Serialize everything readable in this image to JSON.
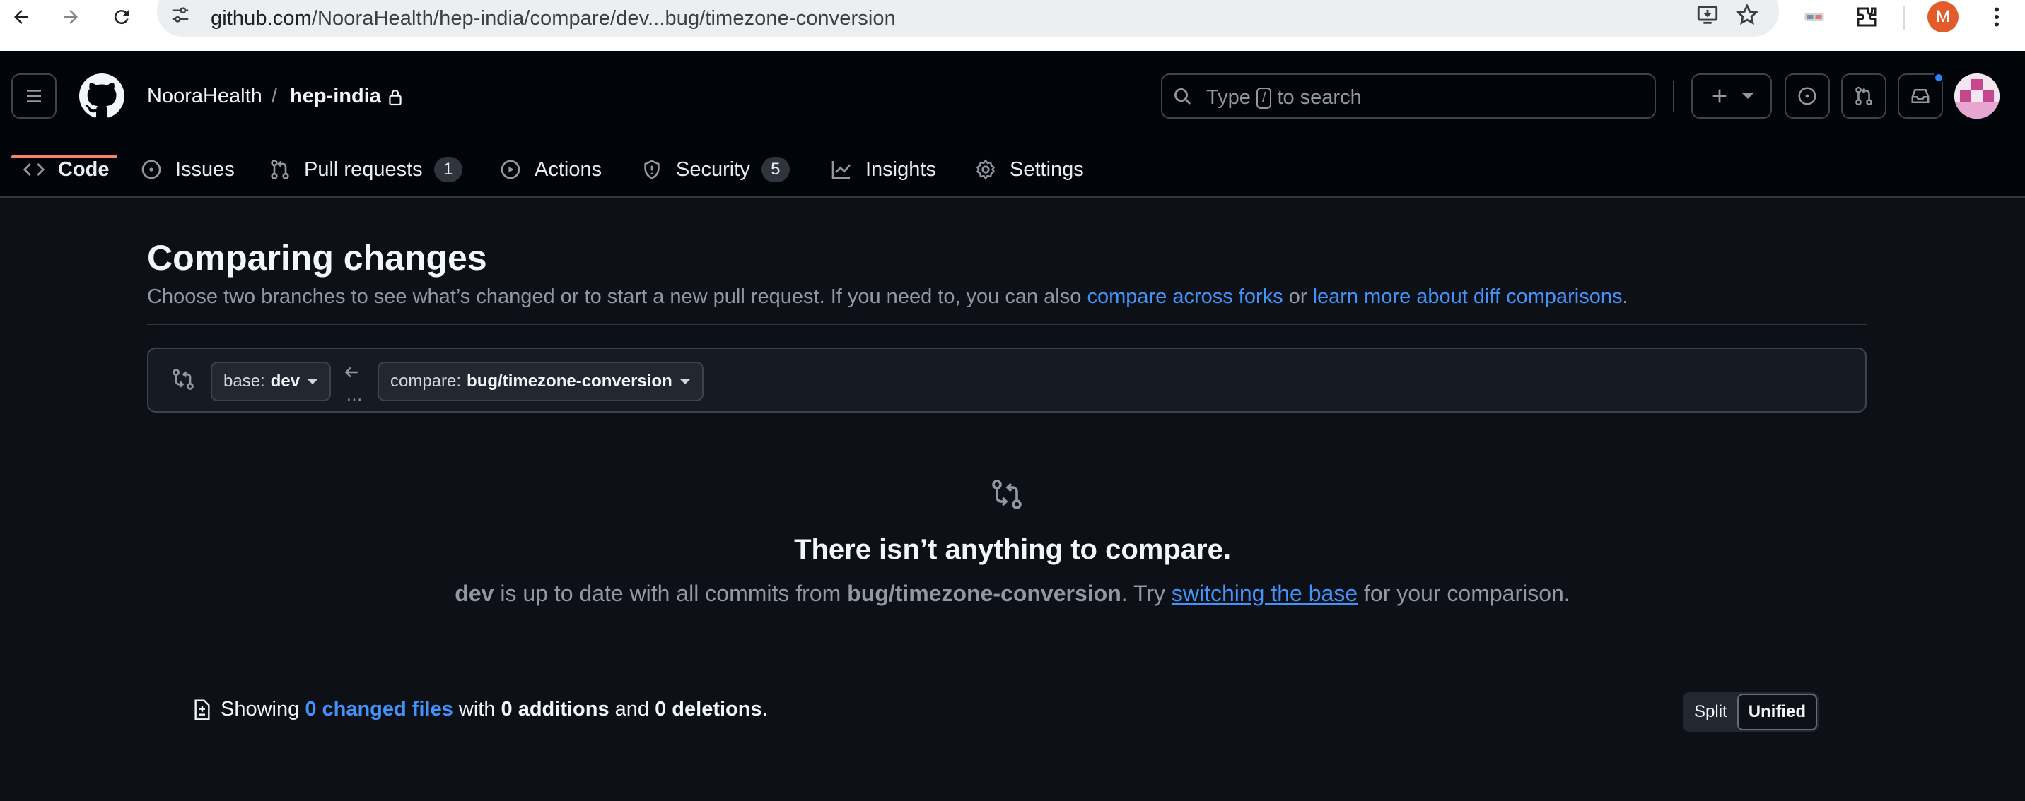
{
  "browser": {
    "url_host": "github.com",
    "url_path": "/NooraHealth/hep-india/compare/dev...bug/timezone-conversion",
    "profile_initial": "M",
    "icons": [
      "back-icon",
      "forward-icon",
      "reload-icon",
      "site-info-icon",
      "install-icon",
      "star-icon",
      "extension-icon",
      "puzzle-icon",
      "menu-dots-icon"
    ]
  },
  "header": {
    "owner": "NooraHealth",
    "separator": "/",
    "repo": "hep-india",
    "search_prefix": "Type",
    "search_key": "/",
    "search_suffix": "to search"
  },
  "tabs": [
    {
      "label": "Code",
      "icon": "code-icon"
    },
    {
      "label": "Issues",
      "icon": "issue-icon"
    },
    {
      "label": "Pull requests",
      "icon": "pull-request-icon",
      "count": "1"
    },
    {
      "label": "Actions",
      "icon": "play-icon"
    },
    {
      "label": "Security",
      "icon": "shield-icon",
      "count": "5"
    },
    {
      "label": "Insights",
      "icon": "graph-icon"
    },
    {
      "label": "Settings",
      "icon": "gear-icon"
    }
  ],
  "main": {
    "title": "Comparing changes",
    "subtitle_text": "Choose two branches to see what’s changed or to start a new pull request. If you need to, you can also",
    "link_forks": "compare across forks",
    "or": "or",
    "link_learn": "learn more about diff comparisons",
    "period": ".",
    "base_label": "base:",
    "base_branch": "dev",
    "compare_label": "compare:",
    "compare_branch": "bug/timezone-conversion",
    "dots": "...",
    "blank_title": "There isn’t anything to compare.",
    "blank_base": "dev",
    "blank_mid": "is up to date with all commits from",
    "blank_head": "bug/timezone-conversion",
    "blank_try": ". Try",
    "blank_link": "switching the base",
    "blank_end": "for your comparison.",
    "showing": "Showing",
    "changed_files": "0 changed files",
    "with": "with",
    "additions": "0 additions",
    "and": "and",
    "deletions": "0 deletions",
    "split": "Split",
    "unified": "Unified"
  },
  "colors": {
    "accent_link": "#4493f8",
    "tab_underline": "#f78166",
    "background": "#0d1117"
  }
}
